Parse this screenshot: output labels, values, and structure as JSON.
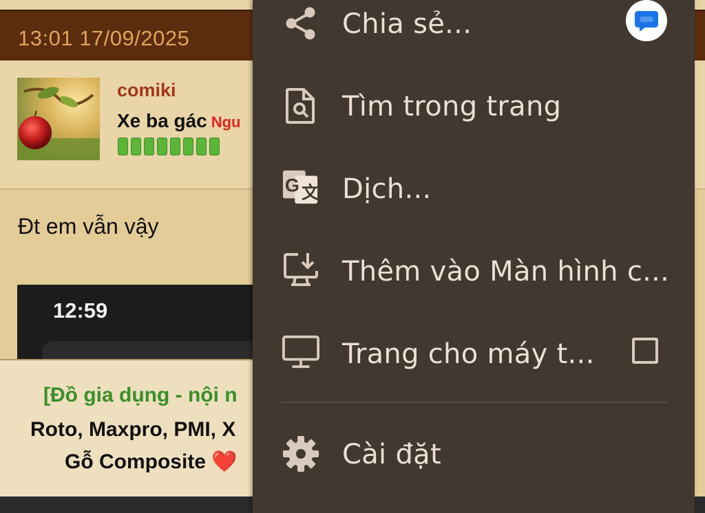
{
  "post": {
    "timestamp": "13:01 17/09/2025",
    "username": "comiki",
    "user_title": "Xe ba gác",
    "user_status": "Ngu",
    "message": "Đt em vẫn vậy",
    "embedded_time": "12:59"
  },
  "ad": {
    "line1": "[Đồ gia dụng - nội n",
    "line2": "Roto, Maxpro, PMI, X",
    "line3": "Gỗ Composite",
    "heart": "❤️"
  },
  "menu": {
    "items": [
      {
        "label": "Chia sẻ...",
        "icon": "share-icon"
      },
      {
        "label": "Tìm trong trang",
        "icon": "find-in-page-icon"
      },
      {
        "label": "Dịch...",
        "icon": "translate-icon"
      },
      {
        "label": "Thêm vào Màn hình c...",
        "icon": "add-to-home-screen-icon"
      },
      {
        "label": "Trang cho máy t...",
        "icon": "desktop-icon",
        "checked": false
      },
      {
        "label": "Cài đặt",
        "icon": "settings-icon"
      }
    ]
  },
  "colors": {
    "menu_bg": "#413830",
    "menu_text": "#ecdfd4",
    "date_bar": "#5b2d0e",
    "page_bg": "#e3cc98",
    "badge_blue": "#1a73e8"
  }
}
